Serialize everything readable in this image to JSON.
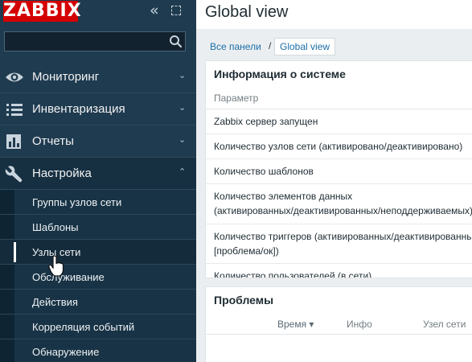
{
  "logo": "ZABBIX",
  "search": {
    "value": "",
    "placeholder": ""
  },
  "menu": [
    {
      "label": "Мониторинг",
      "icon": "eye-icon",
      "chevron": "⌄"
    },
    {
      "label": "Инвентаризация",
      "icon": "list-icon",
      "chevron": "⌄"
    },
    {
      "label": "Отчеты",
      "icon": "bar-chart-icon",
      "chevron": "⌄"
    },
    {
      "label": "Настройка",
      "icon": "wrench-icon",
      "chevron": "⌃"
    }
  ],
  "submenu": [
    {
      "label": "Группы узлов сети"
    },
    {
      "label": "Шаблоны"
    },
    {
      "label": "Узлы сети"
    },
    {
      "label": "Обслуживание"
    },
    {
      "label": "Действия"
    },
    {
      "label": "Корреляция событий"
    },
    {
      "label": "Обнаружение"
    }
  ],
  "page": {
    "title": "Global view",
    "breadcrumb": {
      "root": "Все панели",
      "separator": "/",
      "current": "Global view"
    }
  },
  "system_widget": {
    "title": "Информация о системе",
    "column_header": "Параметр",
    "rows": [
      {
        "text": "Zabbix сервер запущен"
      },
      {
        "text": "Количество узлов сети (активировано/деактивировано)"
      },
      {
        "text": "Количество шаблонов"
      },
      {
        "line1": "Количество элементов данных",
        "line2": "(активированных/деактивированных/неподдерживаемых)"
      },
      {
        "line1": "Количество триггеров (активированных/деактивированных",
        "line2": "[проблема/ок])"
      },
      {
        "text": "Количество пользователей (в сети)"
      }
    ]
  },
  "problems_widget": {
    "title": "Проблемы",
    "headers": {
      "time": "Время ▾",
      "info": "Инфо",
      "host": "Узел сети"
    }
  },
  "colors": {
    "sidebar_bg": "#1f3b50",
    "logo_bg": "#d40000",
    "link": "#1a6ea8"
  }
}
